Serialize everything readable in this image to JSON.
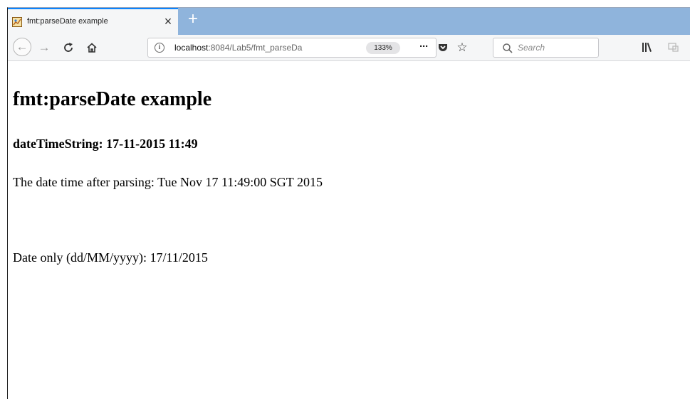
{
  "browser": {
    "tab": {
      "title": "fmt:parseDate example",
      "favicon": "favicon-icon",
      "close_label": "×"
    },
    "new_tab_label": "+",
    "nav": {
      "back_label": "←",
      "forward_label": "→",
      "reload_label": "C",
      "home_label": "⌂"
    },
    "url": {
      "host": "localhost",
      "path": ":8084/Lab5/fmt_parseDa",
      "zoom": "133%",
      "actions_label": "···",
      "bookmark_label": "☆"
    },
    "search": {
      "placeholder": "Search"
    },
    "colors": {
      "tab_strip": "#8fb4dc",
      "toolbar": "#f5f6f7",
      "active_tab_accent": "#0a84ff"
    }
  },
  "page": {
    "heading": "fmt:parseDate example",
    "subheading": "dateTimeString: 17-11-2015 11:49",
    "parsed_line": "The date time after parsing: Tue Nov 17 11:49:00 SGT 2015",
    "date_only_line": "Date only (dd/MM/yyyy): 17/11/2015"
  }
}
